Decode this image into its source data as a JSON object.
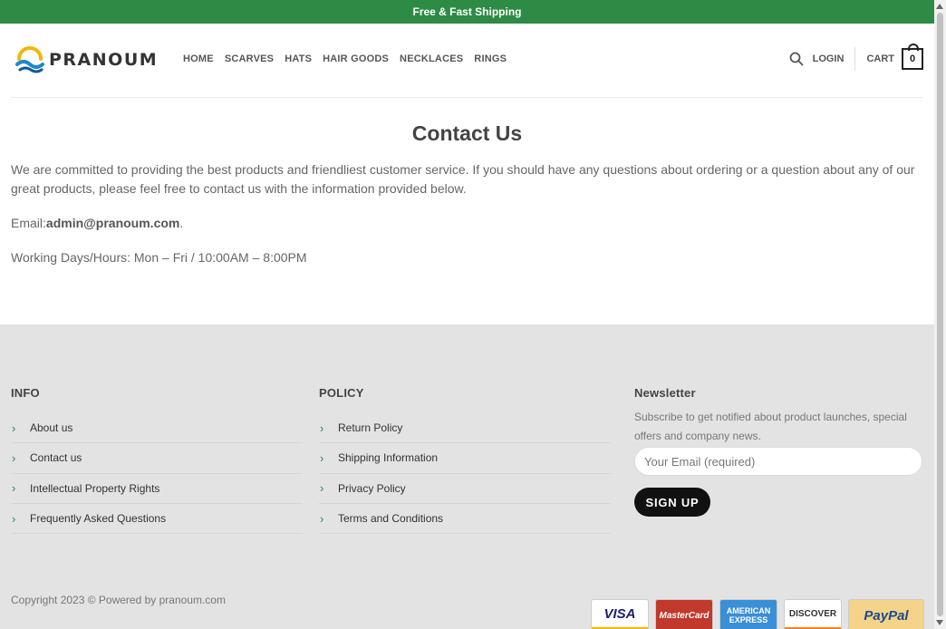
{
  "topbar": {
    "text": "Free & Fast Shipping"
  },
  "header": {
    "logo_text": "PRANOUM",
    "nav": [
      "HOME",
      "SCARVES",
      "HATS",
      "HAIR GOODS",
      "NECKLACES",
      "RINGS"
    ],
    "login_label": "LOGIN",
    "cart_label": "CART",
    "cart_count": "0",
    "icons": {
      "search": "search-icon",
      "cart": "bag-icon"
    }
  },
  "page": {
    "title": "Contact Us",
    "intro": "We are committed to providing the best products and friendliest customer service. If you should have any questions about ordering or a question about any of our great products, please feel free to contact us with the information provided below.",
    "email_label": "Email:",
    "email_value": "admin@pranoum.com",
    "email_suffix": ".",
    "hours": "Working Days/Hours: Mon – Fri / 10:00AM – 8:00PM"
  },
  "footer": {
    "info": {
      "heading": "INFO",
      "items": [
        "About us",
        "Contact us",
        "Intellectual Property Rights",
        "Frequently Asked Questions"
      ]
    },
    "policy": {
      "heading": "POLICY",
      "items": [
        "Return Policy",
        "Shipping Information",
        "Privacy Policy",
        "Terms and Conditions"
      ]
    },
    "newsletter": {
      "heading": "Newsletter",
      "text": "Subscribe to get notified about product launches, special offers and company news.",
      "email_placeholder": "Your Email (required)",
      "button_label": "SIGN UP"
    },
    "copyright": "Copyright 2023 © Powered by pranoum.com",
    "payments": {
      "visa": "VISA",
      "mastercard": "MasterCard",
      "amex": "AMERICAN EXPRESS",
      "discover": "DISCOVER",
      "paypal": "PayPal"
    }
  },
  "colors": {
    "accent_green": "#2e8b45",
    "footer_bg": "#e3e3e3",
    "button_dark": "#111111"
  }
}
